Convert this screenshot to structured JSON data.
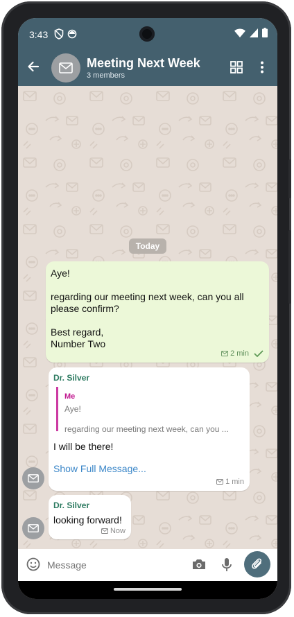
{
  "status_bar": {
    "time": "3:43"
  },
  "header": {
    "title": "Meeting Next Week",
    "subtitle": "3 members",
    "accent": "#44606e"
  },
  "chat": {
    "date_separator": "Today",
    "messages": [
      {
        "direction": "outgoing",
        "lines": [
          "Aye!",
          "",
          "regarding our meeting next week, can you all please confirm?",
          "",
          "Best regard,",
          "Number Two"
        ],
        "time": "2 min",
        "status": "check-icon"
      },
      {
        "direction": "incoming",
        "sender": "Dr. Silver",
        "quote": {
          "name": "Me",
          "line1": "Aye!",
          "line2": "regarding our meeting next week, can you ..."
        },
        "text": "I will be there!",
        "link": "Show Full Message...",
        "time": "1 min"
      },
      {
        "direction": "incoming",
        "sender": "Dr. Silver",
        "text": "looking forward!",
        "time": "Now"
      }
    ]
  },
  "input": {
    "placeholder": "Message"
  }
}
